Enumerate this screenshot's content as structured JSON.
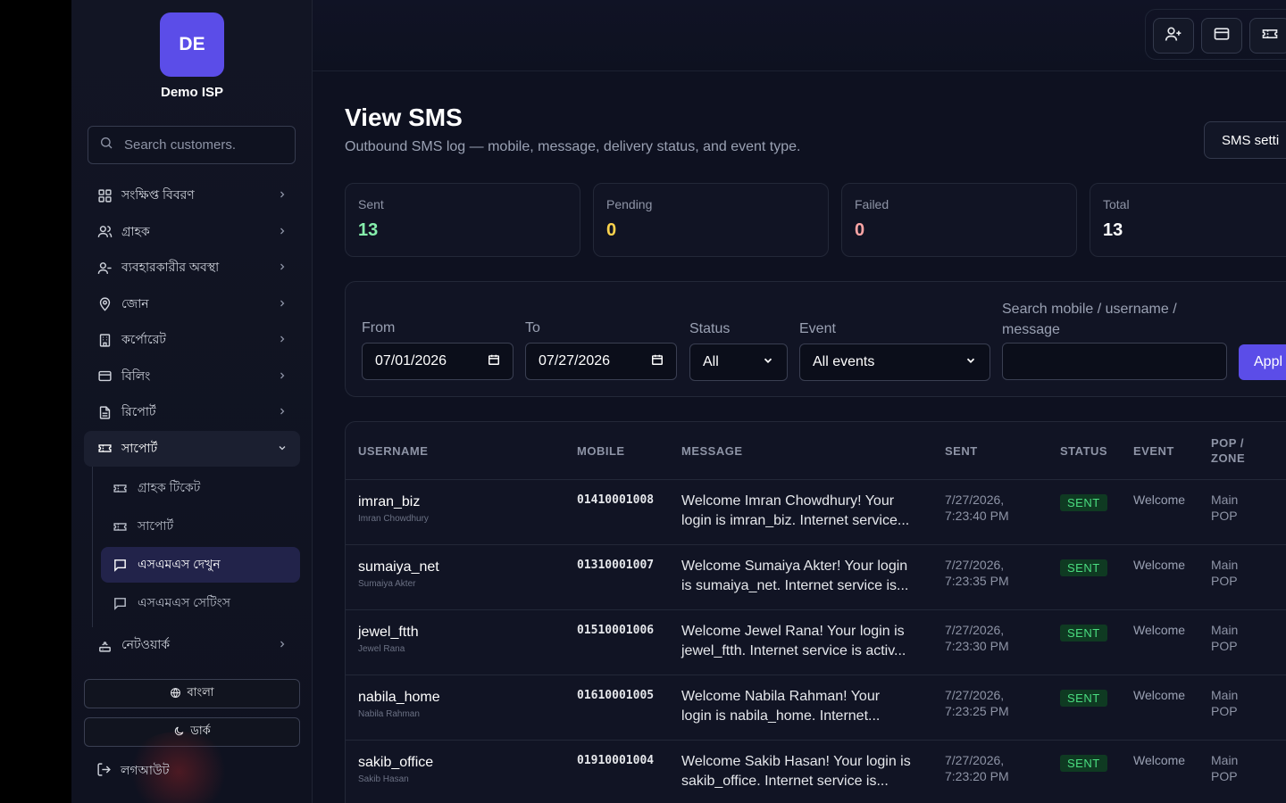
{
  "brand": {
    "initials": "DE",
    "name": "Demo ISP"
  },
  "search": {
    "placeholder": "Search customers."
  },
  "nav": {
    "items": [
      {
        "label": "সংক্ষিপ্ত বিবরণ"
      },
      {
        "label": "গ্রাহক"
      },
      {
        "label": "ব্যবহারকারীর অবস্থা"
      },
      {
        "label": "জোন"
      },
      {
        "label": "কর্পোরেট"
      },
      {
        "label": "বিলিং"
      },
      {
        "label": "রিপোর্ট"
      },
      {
        "label": "সাপোর্ট"
      },
      {
        "label": "নেটওয়ার্ক"
      }
    ],
    "sub": [
      {
        "label": "গ্রাহক টিকেট"
      },
      {
        "label": "সাপোর্ট"
      },
      {
        "label": "এসএমএস দেখুন"
      },
      {
        "label": "এসএমএস সেটিংস"
      }
    ]
  },
  "sidebar_footer": {
    "language": "বাংলা",
    "theme": "ডার্ক",
    "logout": "লগআউট"
  },
  "page": {
    "title": "View SMS",
    "subtitle": "Outbound SMS log — mobile, message, delivery status, and event type.",
    "settings_button": "SMS setti"
  },
  "stats": [
    {
      "label": "Sent",
      "value": "13",
      "color": "#86efac"
    },
    {
      "label": "Pending",
      "value": "0",
      "color": "#fcd34d"
    },
    {
      "label": "Failed",
      "value": "0",
      "color": "#fca5a5"
    },
    {
      "label": "Total",
      "value": "13",
      "color": "#ffffff"
    }
  ],
  "filters": {
    "from_label": "From",
    "from_value": "07/01/2026",
    "to_label": "To",
    "to_value": "07/27/2026",
    "status_label": "Status",
    "status_value": "All",
    "event_label": "Event",
    "event_value": "All events",
    "search_label": "Search mobile / username / message",
    "search_label_line1": "Search mobile / username /",
    "search_label_line2": "message",
    "search_value": "",
    "apply": "Appl"
  },
  "table": {
    "headers": {
      "username": "USERNAME",
      "mobile": "MOBILE",
      "message": "MESSAGE",
      "sent": "SENT",
      "status": "STATUS",
      "event": "EVENT",
      "pop_l1": "POP /",
      "pop_l2": "ZONE"
    },
    "rows": [
      {
        "username": "imran_biz",
        "name": "Imran Chowdhury",
        "mobile": "01410001008",
        "msg1": "Welcome Imran Chowdhury! Your",
        "msg2": "login is imran_biz. Internet service...",
        "date": "7/27/2026,",
        "time": "7:23:40 PM",
        "status": "SENT",
        "event": "Welcome",
        "pop1": "Main",
        "pop2": "POP"
      },
      {
        "username": "sumaiya_net",
        "name": "Sumaiya Akter",
        "mobile": "01310001007",
        "msg1": "Welcome Sumaiya Akter! Your login",
        "msg2": "is sumaiya_net. Internet service is...",
        "date": "7/27/2026,",
        "time": "7:23:35 PM",
        "status": "SENT",
        "event": "Welcome",
        "pop1": "Main",
        "pop2": "POP"
      },
      {
        "username": "jewel_ftth",
        "name": "Jewel Rana",
        "mobile": "01510001006",
        "msg1": "Welcome Jewel Rana! Your login is",
        "msg2": "jewel_ftth. Internet service is activ...",
        "date": "7/27/2026,",
        "time": "7:23:30 PM",
        "status": "SENT",
        "event": "Welcome",
        "pop1": "Main",
        "pop2": "POP"
      },
      {
        "username": "nabila_home",
        "name": "Nabila Rahman",
        "mobile": "01610001005",
        "msg1": "Welcome Nabila Rahman! Your",
        "msg2": "login is nabila_home. Internet...",
        "date": "7/27/2026,",
        "time": "7:23:25 PM",
        "status": "SENT",
        "event": "Welcome",
        "pop1": "Main",
        "pop2": "POP"
      },
      {
        "username": "sakib_office",
        "name": "Sakib Hasan",
        "mobile": "01910001004",
        "msg1": "Welcome Sakib Hasan! Your login is",
        "msg2": "sakib_office. Internet service is...",
        "date": "7/27/2026,",
        "time": "7:23:20 PM",
        "status": "SENT",
        "event": "Welcome",
        "pop1": "Main",
        "pop2": "POP"
      }
    ]
  },
  "colors": {
    "accent": "#5b4de8",
    "badge_bg": "#0f3a22",
    "badge_text": "#4ade80"
  },
  "icons": {
    "topbar": [
      "add-user-icon",
      "card-icon",
      "ticket-icon"
    ]
  }
}
